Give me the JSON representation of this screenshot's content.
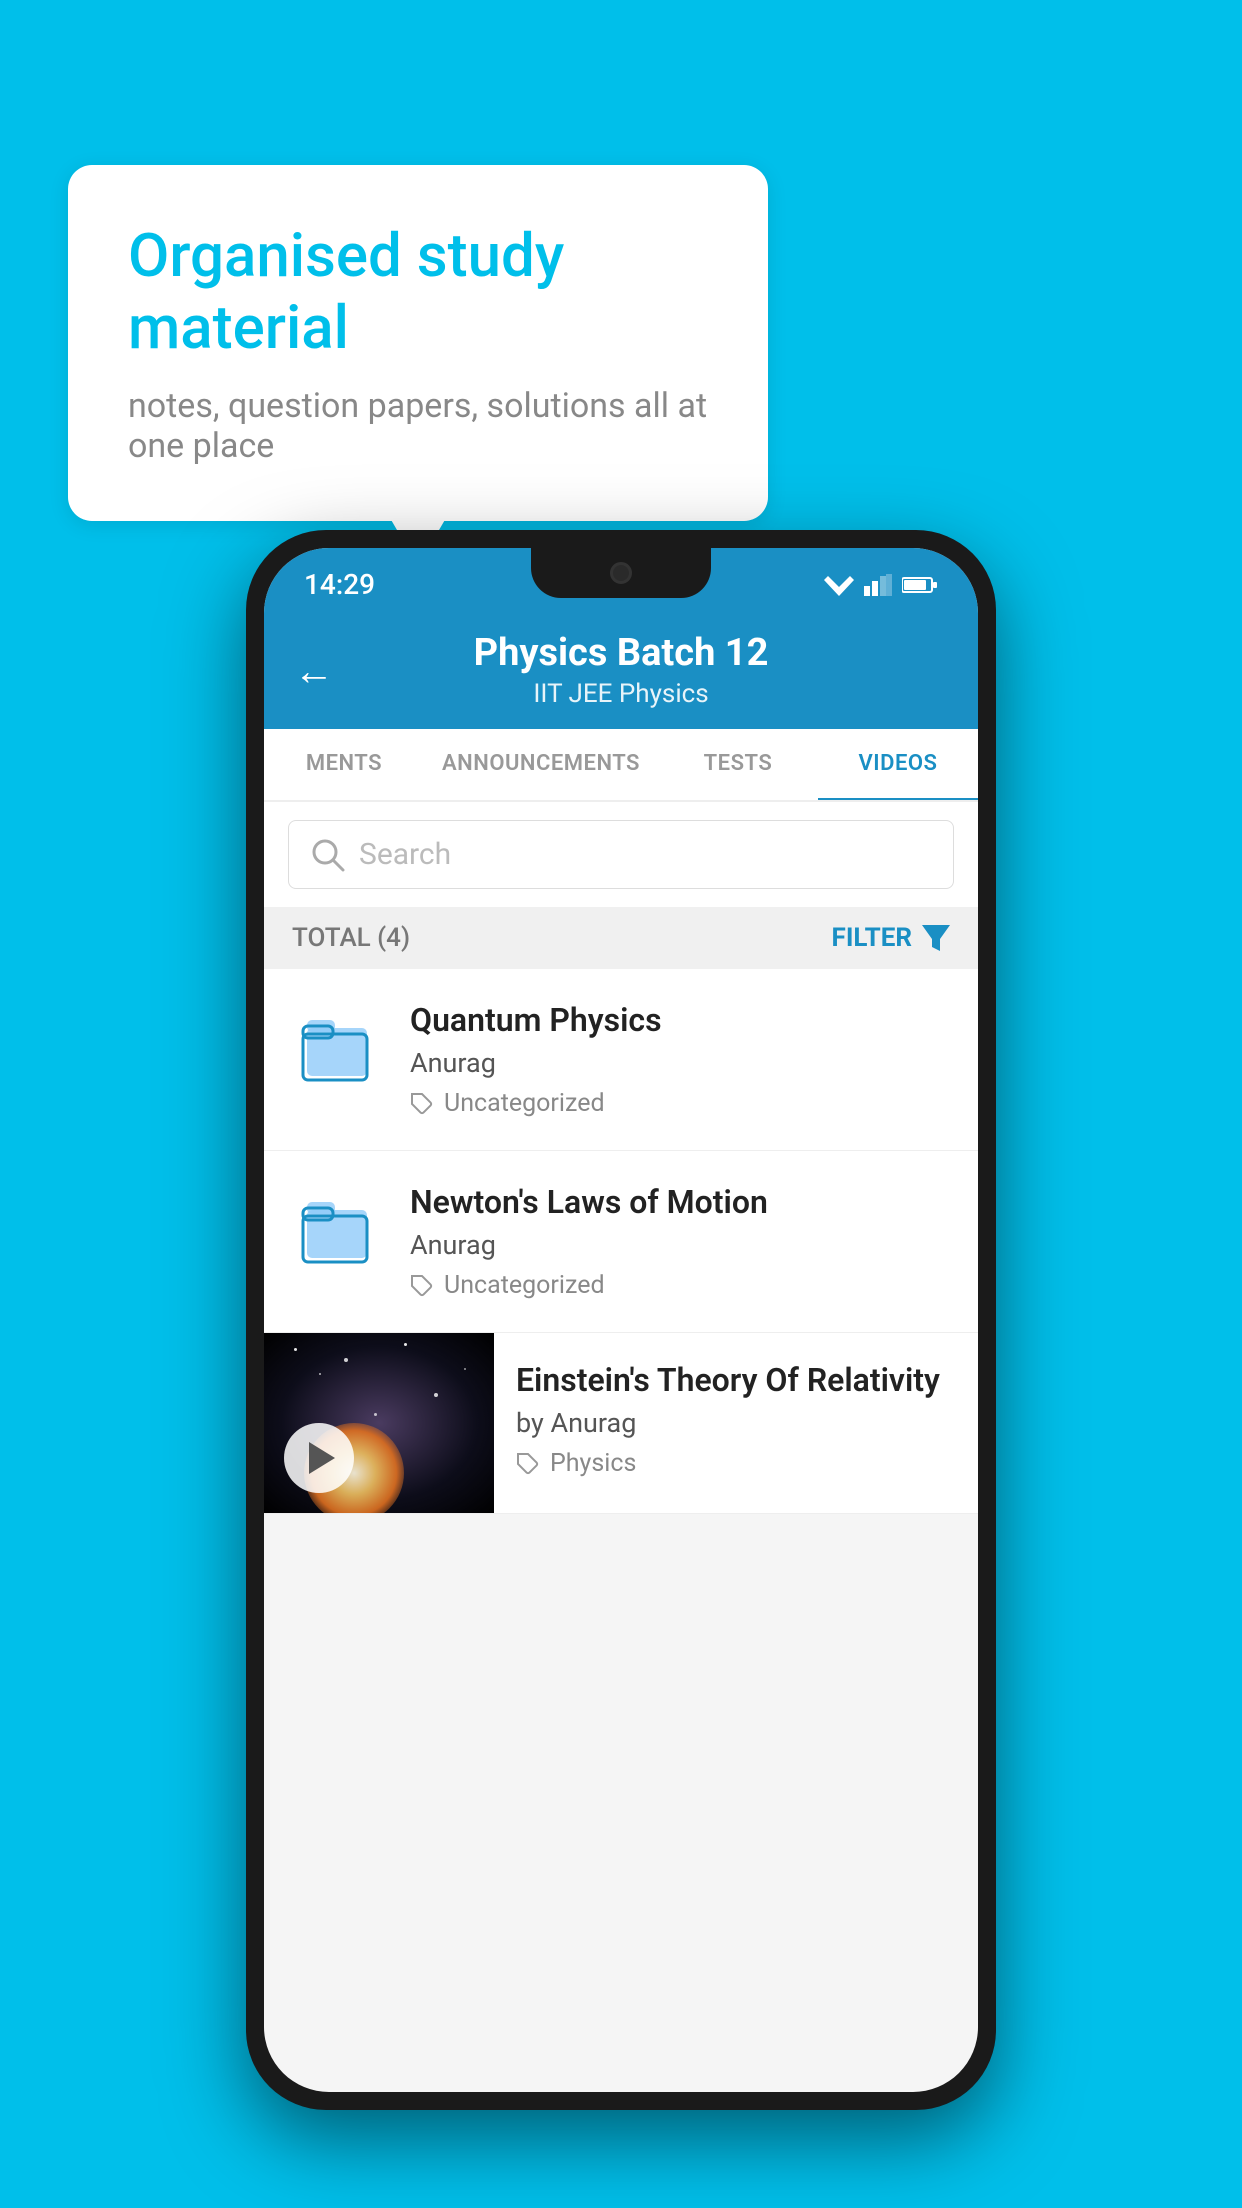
{
  "background_color": "#00BFEA",
  "speech_bubble": {
    "title": "Organised study material",
    "subtitle": "notes, question papers, solutions all at one place"
  },
  "status_bar": {
    "time": "14:29",
    "wifi": "▾",
    "signal": "▾",
    "battery": "▮"
  },
  "header": {
    "title": "Physics Batch 12",
    "subtitle": "IIT JEE   Physics",
    "back_label": "←"
  },
  "tabs": [
    {
      "label": "MENTS",
      "active": false
    },
    {
      "label": "ANNOUNCEMENTS",
      "active": false
    },
    {
      "label": "TESTS",
      "active": false
    },
    {
      "label": "VIDEOS",
      "active": true
    }
  ],
  "search": {
    "placeholder": "Search"
  },
  "filter_bar": {
    "total_label": "TOTAL (4)",
    "filter_label": "FILTER"
  },
  "items": [
    {
      "title": "Quantum Physics",
      "author": "Anurag",
      "tag": "Uncategorized",
      "has_thumbnail": false
    },
    {
      "title": "Newton's Laws of Motion",
      "author": "Anurag",
      "tag": "Uncategorized",
      "has_thumbnail": false
    },
    {
      "title": "Einstein's Theory Of Relativity",
      "author": "by Anurag",
      "tag": "Physics",
      "has_thumbnail": true
    }
  ]
}
